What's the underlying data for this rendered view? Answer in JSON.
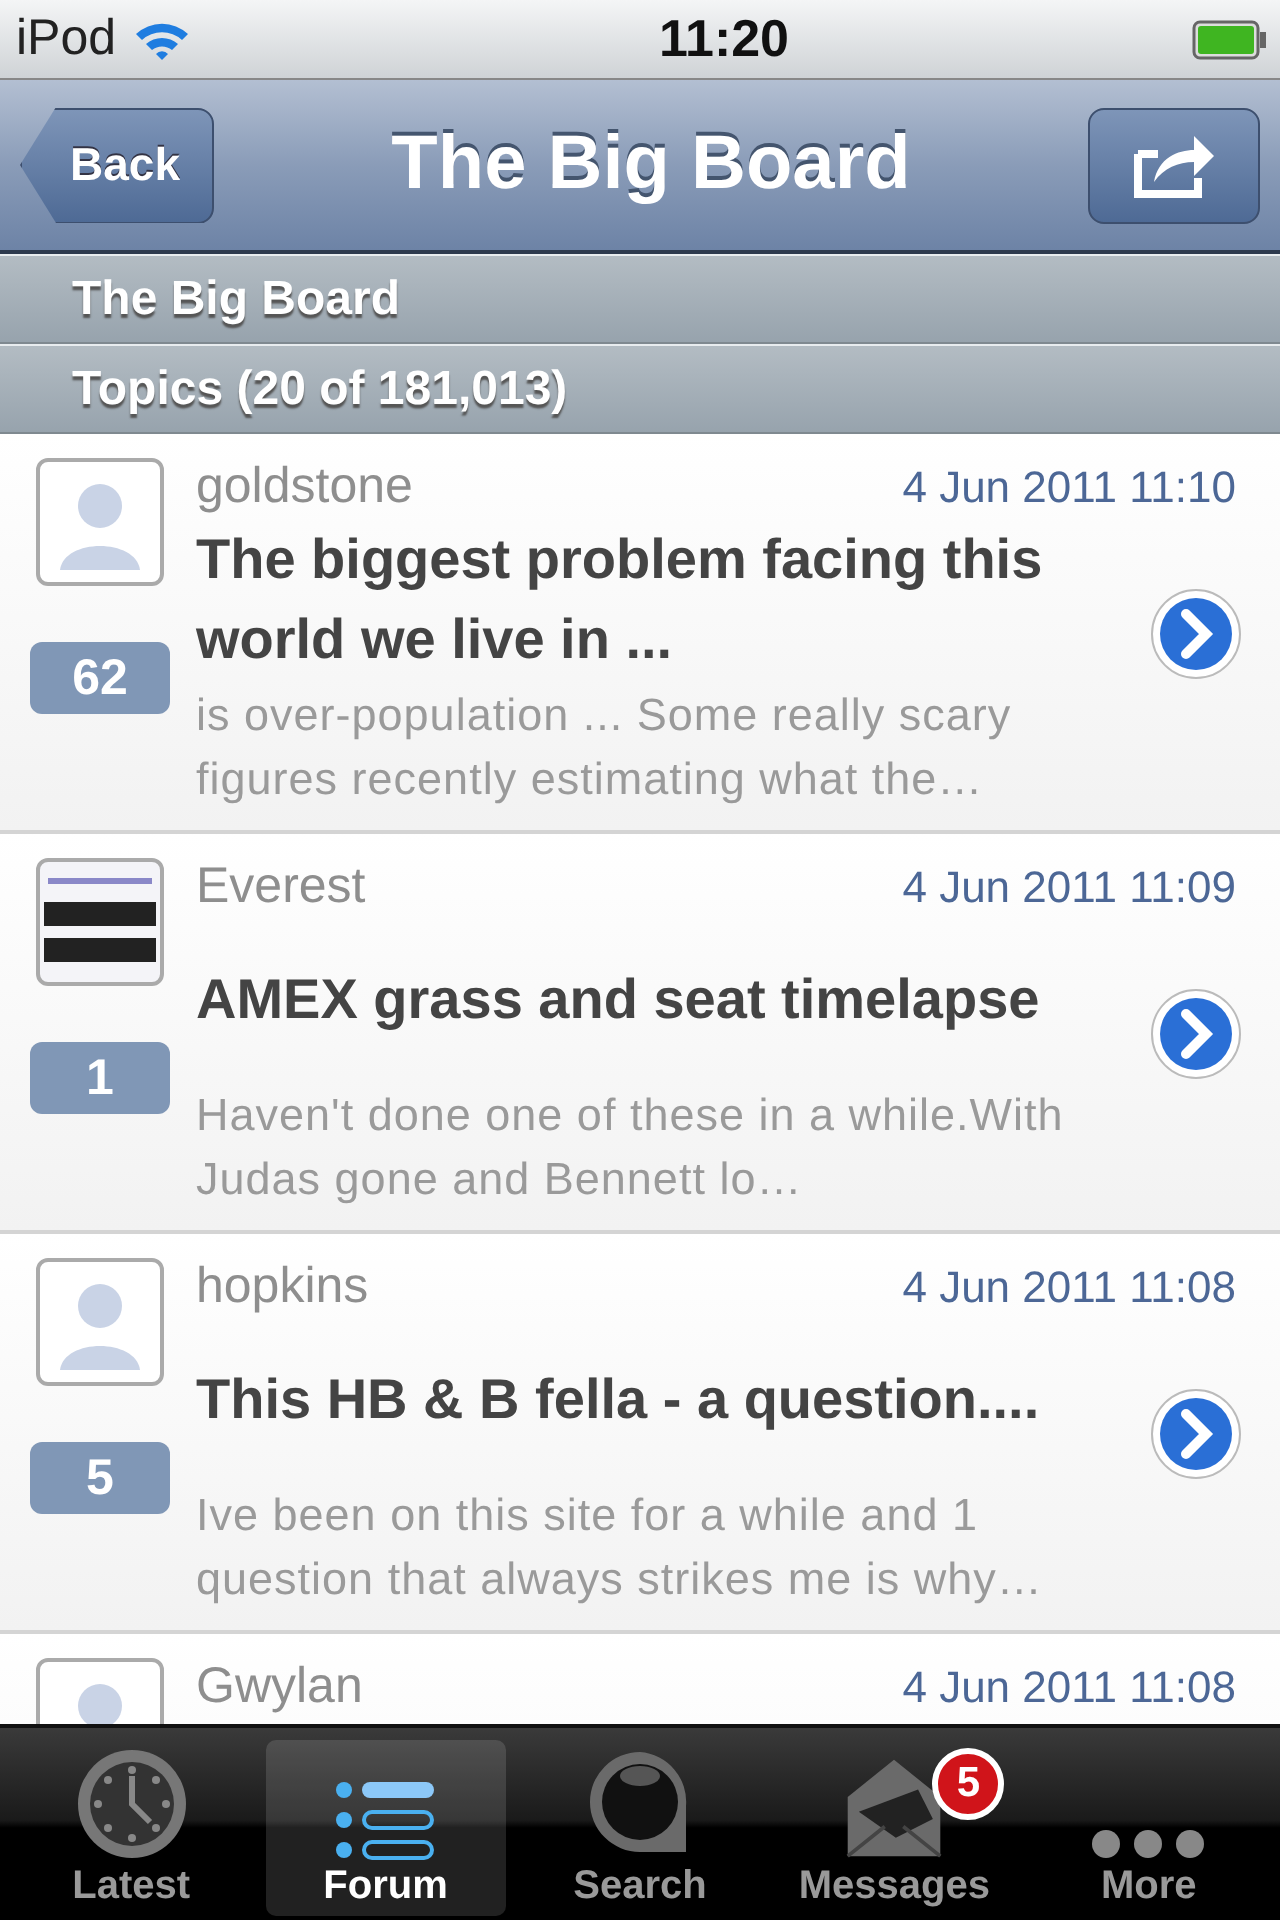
{
  "status_bar": {
    "device": "iPod",
    "time": "11:20"
  },
  "nav_bar": {
    "back": "Back",
    "title": "The Big Board"
  },
  "section_header": "The Big Board",
  "topics_header": "Topics (20 of 181,013)",
  "topics": [
    {
      "avatar": {
        "kind": "default"
      },
      "user": "goldstone",
      "date": "4 Jun 2011 11:10",
      "title": "The biggest problem facing this world we live in ...",
      "snippet": "is over-population ... Some really scary figures recently estimating what the…",
      "replies": "62"
    },
    {
      "user": "Everest",
      "date": "4 Jun 2011 11:09",
      "title": "AMEX grass and seat timelapse",
      "snippet": "Haven't done one of these in a while.With Judas gone and Bennett lo…",
      "replies": "1"
    },
    {
      "avatar": {
        "kind": "default"
      },
      "user": "hopkins",
      "date": "4 Jun 2011 11:08",
      "title": "This HB & B fella - a question....",
      "snippet": "Ive been on this site for a while and 1 question that always strikes me is why…",
      "replies": "5"
    },
    {
      "avatar": {
        "kind": "default"
      },
      "user": "Gwylan",
      "date": "4 Jun 2011 11:08"
    }
  ],
  "tab_bar": [
    {
      "kind": "clock",
      "label": "Latest",
      "selected": false
    },
    {
      "kind": "list",
      "label": "Forum",
      "selected": true
    },
    {
      "kind": "search",
      "label": "Search",
      "selected": false
    },
    {
      "kind": "envelope",
      "label": "Messages",
      "selected": false,
      "badge": "5"
    },
    {
      "kind": "dots",
      "label": "More",
      "selected": false
    }
  ]
}
